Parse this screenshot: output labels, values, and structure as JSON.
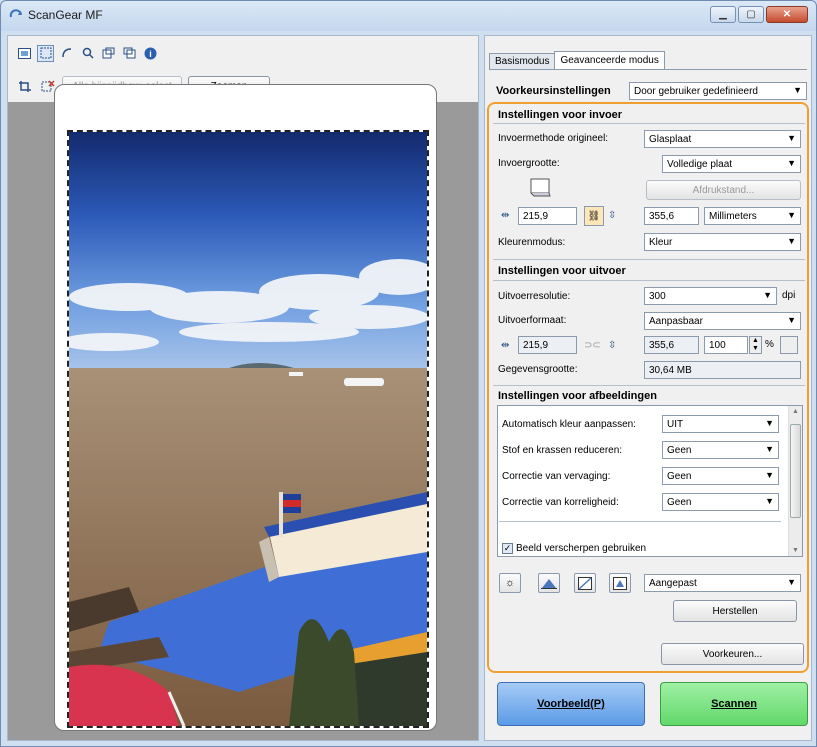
{
  "window": {
    "title": "ScanGear MF"
  },
  "left": {
    "crop_select_label": "Alle bijsnijdbew. select",
    "zoom_label": "Zoomen"
  },
  "tabs": [
    {
      "label": "Basismodus"
    },
    {
      "label": "Geavanceerde modus"
    }
  ],
  "favorites": {
    "label": "Voorkeursinstellingen",
    "value": "Door gebruiker gedefinieerd"
  },
  "input": {
    "heading": "Instellingen voor invoer",
    "method_label": "Invoermethode origineel:",
    "method_value": "Glasplaat",
    "size_label": "Invoergrootte:",
    "size_value": "Volledige plaat",
    "print_button": "Afdrukstand...",
    "width": "215,9",
    "height": "355,6",
    "unit": "Millimeters",
    "color_label": "Kleurenmodus:",
    "color_value": "Kleur"
  },
  "output": {
    "heading": "Instellingen voor uitvoer",
    "resolution_label": "Uitvoerresolutie:",
    "resolution_value": "300",
    "dpi": "dpi",
    "format_label": "Uitvoerformaat:",
    "format_value": "Aanpasbaar",
    "width": "215,9",
    "height": "355,6",
    "scale": "100",
    "percent": "%",
    "datasize_label": "Gegevensgrootte:",
    "datasize_value": "30,64 MB"
  },
  "image": {
    "heading": "Instellingen voor afbeeldingen",
    "rows": [
      {
        "label": "Automatisch kleur aanpassen:",
        "value": "UIT"
      },
      {
        "label": "Stof en krassen reduceren:",
        "value": "Geen"
      },
      {
        "label": "Correctie van vervaging:",
        "value": "Geen"
      },
      {
        "label": "Correctie van korreligheid:",
        "value": "Geen"
      }
    ],
    "sharpen_label": "Beeld verscherpen gebruiken",
    "adjust_value": "Aangepast",
    "reset_button": "Herstellen"
  },
  "prefs_button": "Voorkeuren...",
  "preview_button": "Voorbeeld(P)",
  "scan_button": "Scannen",
  "colors": {
    "accent_orange": "#f0a030",
    "preview_blue": "#5b9be6",
    "scan_green": "#62d86a"
  }
}
